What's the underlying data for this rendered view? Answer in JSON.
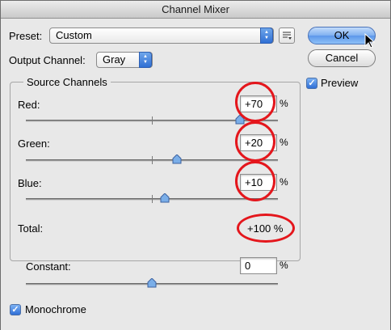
{
  "window": {
    "title": "Channel Mixer"
  },
  "preset": {
    "label": "Preset:",
    "value": "Custom"
  },
  "output_channel": {
    "label": "Output Channel:",
    "value": "Gray"
  },
  "buttons": {
    "ok": "OK",
    "cancel": "Cancel"
  },
  "preview": {
    "label": "Preview",
    "checked": true
  },
  "source_channels": {
    "title": "Source Channels",
    "red": {
      "label": "Red:",
      "value": "+70",
      "unit": "%",
      "level": 0.85
    },
    "green": {
      "label": "Green:",
      "value": "+20",
      "unit": "%",
      "level": 0.6
    },
    "blue": {
      "label": "Blue:",
      "value": "+10",
      "unit": "%",
      "level": 0.55
    },
    "total": {
      "label": "Total:",
      "value": "+100 %"
    }
  },
  "constant": {
    "label": "Constant:",
    "value": "0",
    "unit": "%",
    "level": 0.5
  },
  "monochrome": {
    "label": "Monochrome",
    "checked": true
  },
  "colors": {
    "annotation": "#e4161c",
    "accent": "#3d7ee0"
  }
}
